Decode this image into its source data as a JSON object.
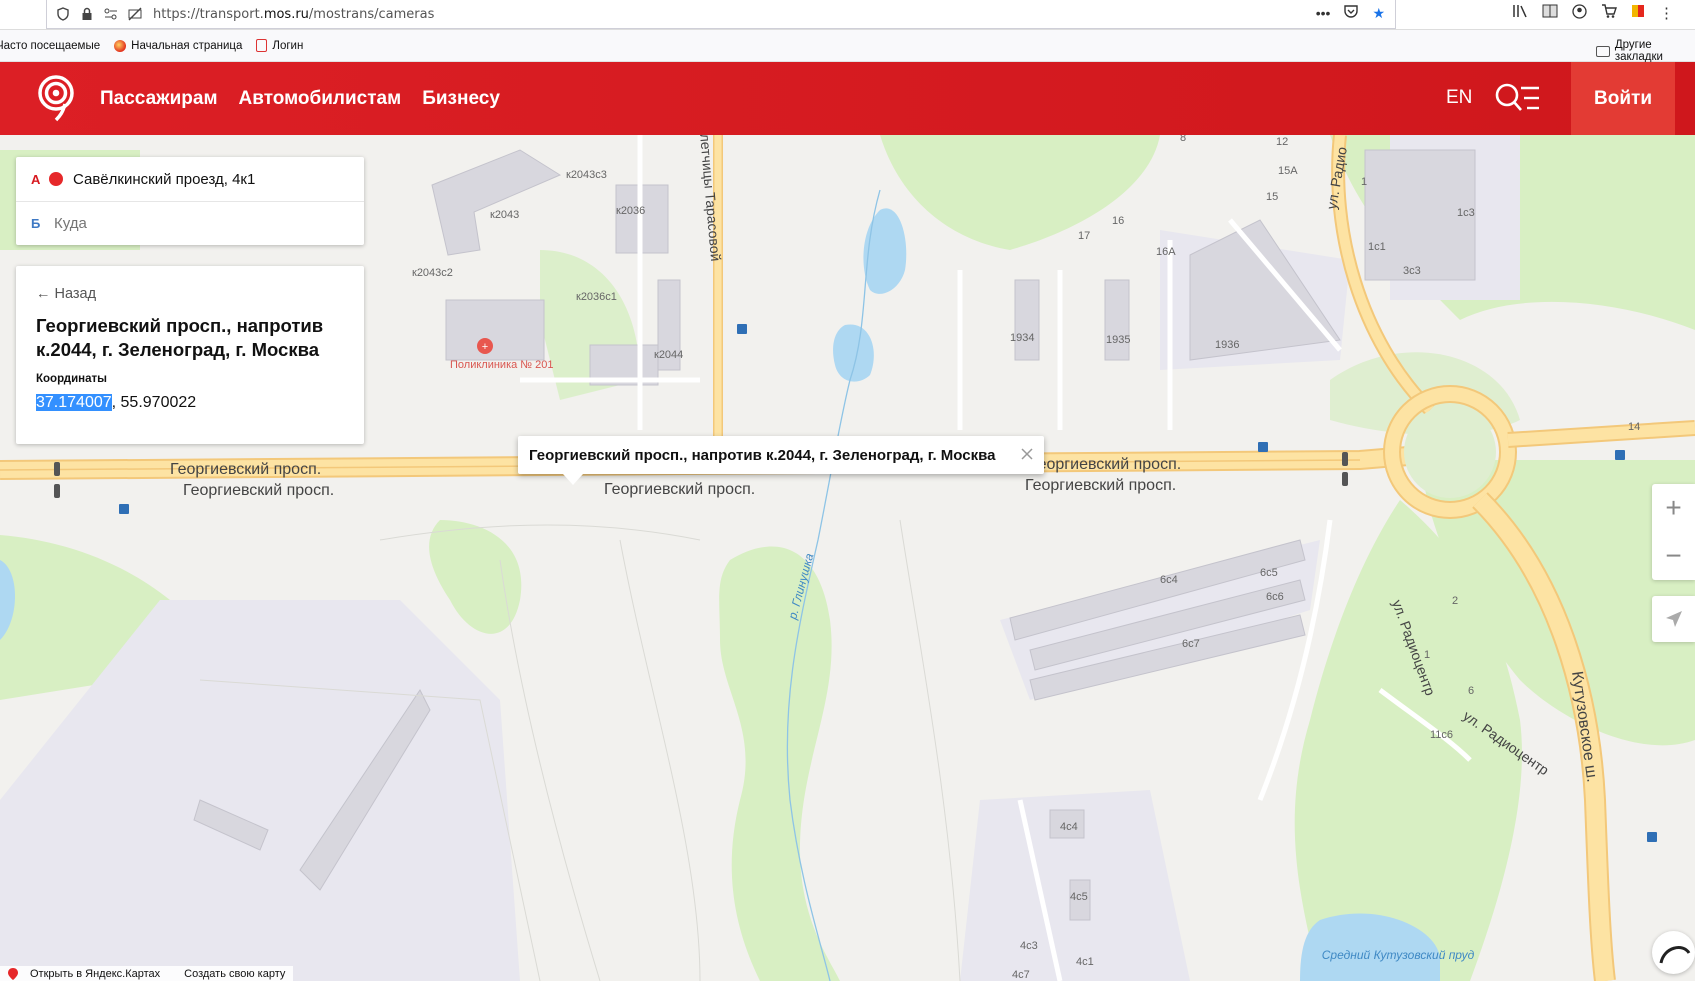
{
  "browser": {
    "url_prefix": "https://transport.",
    "url_domain": "mos.ru",
    "url_path": "/mostrans/cameras",
    "bookmarks": [
      "Часто посещаемые",
      "Начальная страница",
      "Логин"
    ],
    "other_bookmarks": "Другие закладки"
  },
  "header": {
    "nav": [
      "Пассажирам",
      "Автомобилистам",
      "Бизнесу"
    ],
    "lang": "EN",
    "login": "Войти"
  },
  "route": {
    "from_letter": "А",
    "from_value": "Савёлкинский проезд, 4к1",
    "to_letter": "Б",
    "to_placeholder": "Куда"
  },
  "camera": {
    "back": "← Назад",
    "title": "Георгиевский просп., напротив к.2044, г. Зеленоград, г. Москва",
    "coords_label": "Координаты",
    "lon": "37.174007",
    "lat_rest": ", 55.970022"
  },
  "popup": {
    "text": "Георгиевский просп., напротив к.2044, г. Зеленоград, г. Москва"
  },
  "map": {
    "streets": [
      "Георгиевский просп.",
      "Георгиевский просп.",
      "Георгиевский просп.",
      "Георгиевский просп.",
      "Георгиевский просп.",
      "ул. Радио",
      "ул. Радиоцентр",
      "ул. Радиоцентр",
      "Кутузовское ш.",
      "летчицы Тарасовой",
      "р. Глинушка"
    ],
    "buildings": [
      "к2043с3",
      "к2043",
      "к2036",
      "к2043с2",
      "к2036с1",
      "к2044",
      "1934",
      "1935",
      "1936",
      "17",
      "16",
      "16А",
      "12",
      "15А",
      "15",
      "8",
      "1",
      "1с1",
      "1с3",
      "3с3",
      "14",
      "6с4",
      "6с5",
      "6с6",
      "6с7",
      "2",
      "1",
      "6",
      "11с6",
      "4с4",
      "4с5",
      "4с3",
      "4с1",
      "4с7"
    ],
    "poi": "Поликлиника № 201",
    "pond": "Средний Кутузовский пруд"
  },
  "footer": {
    "open_yandex": "Открыть в Яндекс.Картах",
    "create_map": "Создать свою карту"
  },
  "colors": {
    "header_red": "#d71920",
    "login_bg": "#e33b34",
    "road": "#fbd98a",
    "green": "#d7efc0",
    "water": "#aed8f2",
    "selection": "#3390ff"
  }
}
